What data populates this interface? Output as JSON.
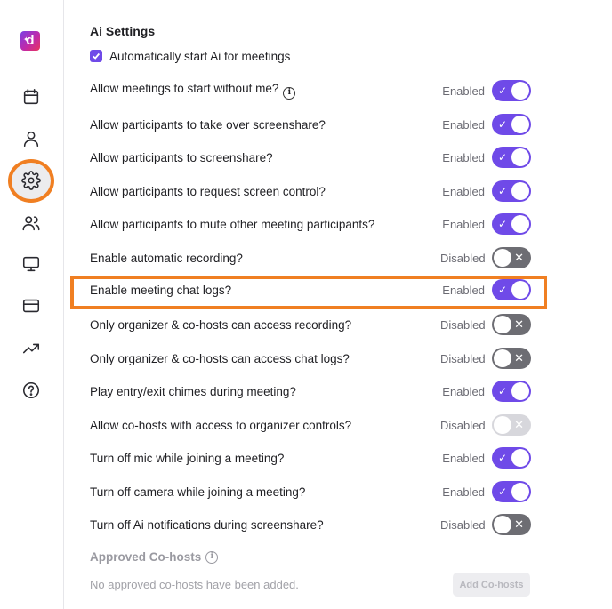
{
  "sidebar": {
    "logo_letter": "d",
    "items": [
      {
        "name": "calendar-icon"
      },
      {
        "name": "user-icon"
      },
      {
        "name": "gear-icon",
        "active": true
      },
      {
        "name": "users-icon"
      },
      {
        "name": "monitor-icon"
      },
      {
        "name": "credit-card-icon"
      },
      {
        "name": "trending-up-icon"
      },
      {
        "name": "help-circle-icon"
      }
    ]
  },
  "colors": {
    "accent": "#6f4ae8",
    "highlight": "#f07f22",
    "toggle_off": "#6d6d73"
  },
  "main": {
    "section_title": "Ai Settings",
    "auto_start_label": "Automatically start Ai for meetings",
    "auto_start_checked": true,
    "settings": [
      {
        "label": "Allow meetings to start without me?",
        "status": "Enabled",
        "on": true,
        "info": true
      },
      {
        "label": "Allow participants to take over screenshare?",
        "status": "Enabled",
        "on": true
      },
      {
        "label": "Allow participants to screenshare?",
        "status": "Enabled",
        "on": true
      },
      {
        "label": "Allow participants to request screen control?",
        "status": "Enabled",
        "on": true
      },
      {
        "label": "Allow participants to mute other meeting participants?",
        "status": "Enabled",
        "on": true
      },
      {
        "label": "Enable automatic recording?",
        "status": "Disabled",
        "on": false
      },
      {
        "label": "Enable meeting chat logs?",
        "status": "Enabled",
        "on": true,
        "highlighted": true
      },
      {
        "label": "Only organizer & co-hosts can access recording?",
        "status": "Disabled",
        "on": false
      },
      {
        "label": "Only organizer & co-hosts can access chat logs?",
        "status": "Disabled",
        "on": false
      },
      {
        "label": "Play entry/exit chimes during meeting?",
        "status": "Enabled",
        "on": true
      },
      {
        "label": "Allow co-hosts with access to organizer controls?",
        "status": "Disabled",
        "on": false,
        "disabled": true
      },
      {
        "label": "Turn off mic while joining a meeting?",
        "status": "Enabled",
        "on": true
      },
      {
        "label": "Turn off camera while joining a meeting?",
        "status": "Enabled",
        "on": true
      },
      {
        "label": "Turn off Ai notifications during screenshare?",
        "status": "Disabled",
        "on": false
      }
    ],
    "cohosts": {
      "title": "Approved Co-hosts",
      "empty_text": "No approved co-hosts have been added.",
      "add_label": "Add Co-hosts"
    }
  }
}
